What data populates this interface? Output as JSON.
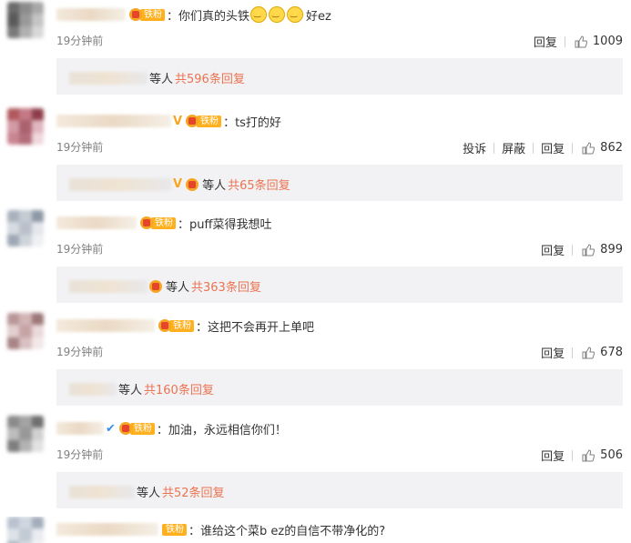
{
  "badge_label": "铁粉",
  "comments": [
    {
      "content_before": "：你们真的头铁",
      "content_after": "好ez",
      "time": "19分钟前",
      "actions": [
        "回复"
      ],
      "likes": "1009",
      "reply_deng": "等人",
      "reply_count": "共596条回复",
      "avatar_colors": [
        "#6b6b6b",
        "#8c8c8c",
        "#a8a8a8",
        "#5a5a5a",
        "#999",
        "#c4c4c4",
        "#7a7a7a",
        "#b0b0b0",
        "#d8d8d8"
      ]
    },
    {
      "content": "：ts打的好",
      "time": "19分钟前",
      "actions": [
        "投诉",
        "屏蔽",
        "回复"
      ],
      "likes": "862",
      "reply_deng": "等人",
      "reply_count": "共65条回复",
      "avatar_colors": [
        "#b0585c",
        "#c47a86",
        "#8d3e4a",
        "#d29aa5",
        "#a9626e",
        "#e0b6bf",
        "#c88592",
        "#b36c7a",
        "#f0d8dd"
      ]
    },
    {
      "content": "：puff菜得我想吐",
      "time": "19分钟前",
      "actions": [
        "回复"
      ],
      "likes": "899",
      "reply_deng": "等人",
      "reply_count": "共363条回复",
      "avatar_colors": [
        "#a9b1bd",
        "#c6ccd4",
        "#8e98a6",
        "#d6dbe2",
        "#b9c0ca",
        "#e4e7ec",
        "#9ea7b4",
        "#cfd4db",
        "#eef0f3"
      ]
    },
    {
      "content": "：这把不会再开上单吧",
      "time": "19分钟前",
      "actions": [
        "回复"
      ],
      "likes": "678",
      "reply_deng": "等人",
      "reply_count": "共160条回复",
      "avatar_colors": [
        "#b99698",
        "#d3b5b6",
        "#9c7779",
        "#e2cfcf",
        "#c5a3a5",
        "#ead9da",
        "#a88485",
        "#d9c0c1",
        "#f3e8e8"
      ]
    },
    {
      "content": "：加油，永远相信你们！",
      "time": "19分钟前",
      "actions": [
        "回复"
      ],
      "likes": "506",
      "reply_deng": "等人",
      "reply_count": "共52条回复",
      "avatar_colors": [
        "#8a8a8a",
        "#a4a4a4",
        "#6f6f6f",
        "#bdbdbd",
        "#989898",
        "#d0d0d0",
        "#7e7e7e",
        "#b3b3b3",
        "#e2e2e2"
      ]
    },
    {
      "content": "：谁给这个菜b ez的自信不带净化的?",
      "avatar_colors": [
        "#b9c2cf",
        "#cfd6df",
        "#a3adbb",
        "#dde2e8",
        "#c2cad4",
        "#e9ecf0",
        "#aeb7c3",
        "#d5dbe2",
        "#f1f3f6"
      ]
    }
  ]
}
